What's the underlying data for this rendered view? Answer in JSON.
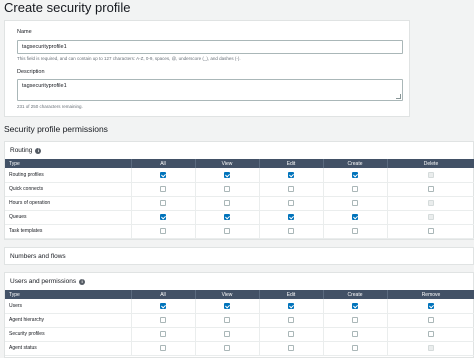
{
  "page": {
    "title": "Create security profile"
  },
  "form": {
    "name_label": "Name",
    "name_value": "tagsecurityprofile1",
    "name_hint": "This field is required, and can contain up to 127 characters: A-Z, 0-9, spaces, @, underscore (_), and dashes (-).",
    "description_label": "Description",
    "description_value": "tagsecurityprofile1",
    "description_hint": "231 of 250 characters remaining."
  },
  "permissions": {
    "heading": "Security profile permissions",
    "routing": {
      "title": "Routing",
      "columns": [
        "Type",
        "All",
        "View",
        "Edit",
        "Create",
        "Delete"
      ],
      "rows": [
        {
          "label": "Routing profiles",
          "states": [
            "on",
            "on",
            "on",
            "on",
            "dis"
          ]
        },
        {
          "label": "Quick connects",
          "states": [
            "off",
            "off",
            "off",
            "off",
            "off"
          ]
        },
        {
          "label": "Hours of operation",
          "states": [
            "off",
            "off",
            "off",
            "off",
            "dis"
          ]
        },
        {
          "label": "Queues",
          "states": [
            "on",
            "on",
            "on",
            "on",
            "dis"
          ]
        },
        {
          "label": "Task templates",
          "states": [
            "off",
            "off",
            "off",
            "off",
            "off"
          ]
        }
      ]
    },
    "numbers": {
      "title": "Numbers and flows"
    },
    "users": {
      "title": "Users and permissions",
      "columns": [
        "Type",
        "All",
        "View",
        "Edit",
        "Create",
        "Remove"
      ],
      "rows": [
        {
          "label": "Users",
          "states": [
            "on",
            "on",
            "on",
            "on",
            "on"
          ]
        },
        {
          "label": "Agent hierarchy",
          "states": [
            "off",
            "off",
            "off",
            "off",
            "off"
          ]
        },
        {
          "label": "Security profiles",
          "states": [
            "off",
            "off",
            "off",
            "off",
            "off"
          ]
        },
        {
          "label": "Agent status",
          "states": [
            "off",
            "off",
            "off",
            "off",
            "dis"
          ]
        }
      ]
    }
  },
  "colors": {
    "header_bg": "#425166",
    "checkbox_on": "#0073bb",
    "page_bg": "#f2f3f3"
  }
}
